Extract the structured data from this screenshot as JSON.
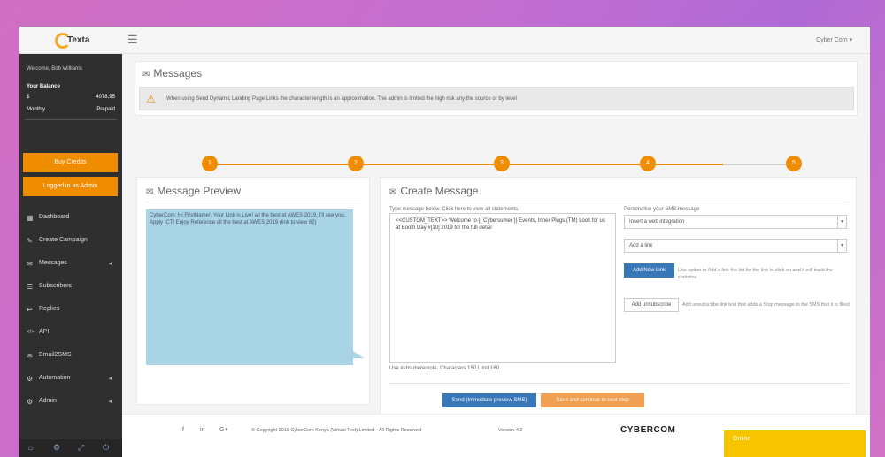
{
  "header": {
    "logo_text": "Texta",
    "user_menu": "Cyber Com ▾"
  },
  "sidebar": {
    "welcome": "Welcome, Bob Williams",
    "balance_label": "Your Balance",
    "balance_rows": [
      {
        "left": "$",
        "right": "4078.95"
      },
      {
        "left": "Monthly",
        "right": "Prepaid"
      }
    ],
    "buy_credits": "Buy Credits",
    "logged_in_as": "Logged in as Admin",
    "items": [
      {
        "icon": "dashboard-icon",
        "glyph": "▦",
        "label": "Dashboard",
        "chevron": ""
      },
      {
        "icon": "create-campaign-icon",
        "glyph": "✎",
        "label": "Create Campaign",
        "chevron": ""
      },
      {
        "icon": "messages-icon",
        "glyph": "✉",
        "label": "Messages",
        "chevron": "◂"
      },
      {
        "icon": "subscribers-icon",
        "glyph": "☰",
        "label": "Subscribers",
        "chevron": ""
      },
      {
        "icon": "replies-icon",
        "glyph": "↩",
        "label": "Replies",
        "chevron": ""
      },
      {
        "icon": "api-icon",
        "glyph": "</>",
        "label": "API",
        "chevron": ""
      },
      {
        "icon": "email-sms-icon",
        "glyph": "✉",
        "label": "Email2SMS",
        "chevron": ""
      },
      {
        "icon": "automation-icon",
        "glyph": "⚙",
        "label": "Automation",
        "chevron": "◂"
      },
      {
        "icon": "admin-icon",
        "glyph": "⚙",
        "label": "Admin",
        "chevron": "◂"
      }
    ]
  },
  "messages_panel": {
    "title": "Messages",
    "alert_text": "When using Send Dynamic Landing Page Links the character length is an approximation. The admin is limited the high risk any the source or by level"
  },
  "steps": [
    "1",
    "2",
    "3",
    "4",
    "5"
  ],
  "preview": {
    "title": "Message Preview",
    "text": "CyberCom: Hi FirstName!, Your Link is Live! all the best at AWES 2019, I'll see you. Apply ICT! Enjoy Reference all the best at AWES 2019 (link to view 82)"
  },
  "create": {
    "title": "Create Message",
    "textarea_label": "Type message below. Click here to view all statements.",
    "textarea_text": "<<CUSTOM_TEXT>> Welcome to {{ Cybersumer }} Events, Inner Plugs (TM) Look for us at Booth Day #[10] 2019 for the full detail",
    "char_hint": "Use #sbsuberemote. Characters 150 Limit 160",
    "personalise_label": "Personalise your SMS message",
    "personalise_select": "Insert a web integration",
    "link_select": "Add a link",
    "add_new_link": "Add New Link",
    "add_new_link_hint": "Use option to Add a link the list for the link to click on and it will track the statistics",
    "add_unsubscribe": "Add unsubscribe",
    "add_unsubscribe_hint": "Add unsubscribe link text that adds a Stop message to the SMS that it is filled",
    "send_button": "Send (Immediate preview SMS)",
    "save_continue": "Save and continue to next step"
  },
  "footer": {
    "facebook": "f",
    "linkedin": "in",
    "gplus": "G+",
    "copyright": "© Copyright 2019 CyberCom Kenya (Virtual Text) Limited - All Rights Reserved",
    "version": "Version 4.2",
    "brand": "CYBERCOM"
  },
  "chat": {
    "label": "Online"
  },
  "colors": {
    "accent": "#f08c00",
    "sidebar_bg": "#2f2f2f",
    "preview_bg": "#a9d4e6",
    "primary_button": "#3878b8"
  }
}
